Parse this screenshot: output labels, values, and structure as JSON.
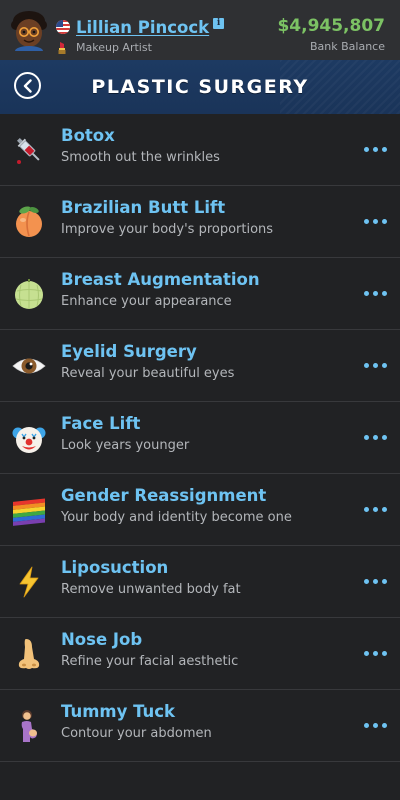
{
  "header": {
    "name": "Lillian Pincock",
    "job": "Makeup Artist",
    "balance": "$4,945,807",
    "balance_label": "Bank Balance",
    "flag_icon": "us-flag-icon",
    "job_icon": "lipstick-icon",
    "verified_icon": "info-icon"
  },
  "title_bar": {
    "title": "PLASTIC SURGERY",
    "back_icon": "back-arrow-icon"
  },
  "colors": {
    "accent_blue": "#6ec3f2",
    "balance_green": "#7cc264",
    "title_bar": "#1d3a62",
    "background": "#212224"
  },
  "procedures": [
    {
      "title": "Botox",
      "subtitle": "Smooth out the wrinkles",
      "icon": "syringe-icon"
    },
    {
      "title": "Brazilian Butt Lift",
      "subtitle": "Improve your body's proportions",
      "icon": "peach-icon"
    },
    {
      "title": "Breast Augmentation",
      "subtitle": "Enhance your appearance",
      "icon": "melon-icon"
    },
    {
      "title": "Eyelid Surgery",
      "subtitle": "Reveal your beautiful eyes",
      "icon": "eye-icon"
    },
    {
      "title": "Face Lift",
      "subtitle": "Look years younger",
      "icon": "clown-face-icon"
    },
    {
      "title": "Gender Reassignment",
      "subtitle": "Your body and identity become one",
      "icon": "rainbow-flag-icon"
    },
    {
      "title": "Liposuction",
      "subtitle": "Remove unwanted body fat",
      "icon": "lightning-icon"
    },
    {
      "title": "Nose Job",
      "subtitle": "Refine your facial aesthetic",
      "icon": "nose-icon"
    },
    {
      "title": "Tummy Tuck",
      "subtitle": "Contour your abdomen",
      "icon": "pregnant-woman-icon"
    }
  ]
}
